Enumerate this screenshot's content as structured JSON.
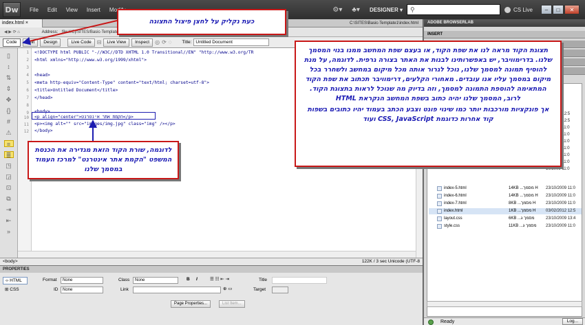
{
  "app": {
    "logo": "Dw",
    "workspace": "DESIGNER",
    "cs_live": "CS Live"
  },
  "menu": [
    "File",
    "Edit",
    "View",
    "Insert",
    "Modify"
  ],
  "document": {
    "tab": "index.html",
    "path": "C:\\SITES\\Basic-Template1\\index.html",
    "address_label": "Address:",
    "address_value": "file:///C|/SITES/Basic-Template1/index.html"
  },
  "toolbar": {
    "code": "Code",
    "split": "Split",
    "design": "Design",
    "live_code": "Live Code",
    "live_view": "Live View",
    "inspect": "Inspect",
    "title_label": "Title:",
    "title_value": "Untitled Document"
  },
  "code_lines": [
    {
      "n": "1",
      "text": "<!DOCTYPE html PUBLIC \"-//W3C//DTD XHTML 1.0 Transitional//EN\" \"http://www.w3.org/TR"
    },
    {
      "n": "2",
      "text": "<html xmlns=\"http://www.w3.org/1999/xhtml\">"
    },
    {
      "n": "3",
      "text": ""
    },
    {
      "n": "4",
      "text": "<head>"
    },
    {
      "n": "5",
      "text": "<meta http-equiv=\"Content-Type\" content=\"text/html; charset=utf-8\">"
    },
    {
      "n": "6",
      "text": "<title>Untitled Document</title>"
    },
    {
      "n": "7",
      "text": "</head>"
    },
    {
      "n": "8",
      "text": ""
    },
    {
      "n": "9",
      "text": "<body>"
    },
    {
      "n": "10",
      "text": "<p align=\"center\">הקמת אתר אינטרנט</p>"
    },
    {
      "n": "11",
      "text": "<p><img alt=\"\" src=\"images/img.jpg\" class=\"img\" /></p>"
    },
    {
      "n": "12",
      "text": "</body>"
    }
  ],
  "status": {
    "tag": "<body>",
    "right": "122K / 3 sec  Unicode (UTF-8"
  },
  "properties": {
    "header": "PROPERTIES",
    "html_btn": "HTML",
    "css_btn": "CSS",
    "format_label": "Format",
    "format_value": "None",
    "class_label": "Class",
    "class_value": "None",
    "id_label": "ID",
    "id_value": "None",
    "link_label": "Link",
    "title_label": "Title",
    "target_label": "Target",
    "bold": "B",
    "italic": "I",
    "page_props": "Page Properties...",
    "list_item": "List Item..."
  },
  "right_panel": {
    "browserlab": "ADOBE BROWSERLAB",
    "insert": "INSERT",
    "col_modified": "odified",
    "files": [
      {
        "name": "",
        "size": "",
        "date": "02/2012 12:5"
      },
      {
        "name": "",
        "size": "",
        "date": "02/2012 12:5"
      },
      {
        "name": "",
        "size": "",
        "date": "10/2009 11:0"
      },
      {
        "name": "",
        "size": "",
        "date": "10/2009 11:0"
      },
      {
        "name": "",
        "size": "",
        "date": "10/2009 11:0"
      },
      {
        "name": "",
        "size": "",
        "date": "10/2009 11:0"
      },
      {
        "name": "",
        "size": "",
        "date": "10/2009 11:0"
      },
      {
        "name": "",
        "size": "",
        "date": "10/2009 11:0"
      },
      {
        "name": "",
        "size": "",
        "date": "10/2009 11:0"
      },
      {
        "name": "index-5.html",
        "size": "14KB ...מסמך H",
        "date": "23/10/2009 11:0"
      },
      {
        "name": "index-6.html",
        "size": "14KB ...מסמך H",
        "date": "23/10/2009 11:0"
      },
      {
        "name": "index-7.html",
        "size": "8KB ...מסמך H",
        "date": "23/10/2009 11:0"
      },
      {
        "name": "index.html",
        "size": "1KB ...מסמך H",
        "date": "03/02/2012 12:5"
      },
      {
        "name": "layout.css",
        "size": "6KB ...מסמך ג",
        "date": "23/10/2009 13:4"
      },
      {
        "name": "style.css",
        "size": "11KB ...מסמך ג",
        "date": "23/10/2009 11:0"
      }
    ],
    "ready": "Ready",
    "log": "Log..."
  },
  "callouts": {
    "top": "כעת נקליק על לחצן פיצול התצוגה",
    "main": "תצוגת הקוד מראה לנו את שפת הקוד, או בעצם שפת המחשב ממנו בנוי המסמך שלנו. בדרימוויבר, יש באפשרותינו לבנות את האתר בצורה גרפית. לדוגמה, על מנת להוסיף תמונה למסמך שלנו, נוכל לגרור אותה מכל מיקום במחשב ולשחרר בכל מיקום במסמך עליו אנו עובדים. מאחורי הקלעים, דרימוויבר תכתוב את שפת הקוד המתאימה להוספת התמונה למסמך, וזה בדיוק מה שנוכל לראות בתצוגת הקוד. לרוב, המסמך שלנו יהיה כתוב בשפת המחשב הנקראת HTML",
    "main2": "אך פונקציות מורכבות יותר כמו שינוי פונט וצבע הכתב בעמוד יהיו כתובים בשפות קוד אחרות כדוגמת CSS, JavaScript ועוד",
    "bottom": "לדוגמה, שורת הקוד הזאת מגדירה את הכנסת המשפט \"הקמת אתר אינטרנט\" למרכז העמוד במסמך שלנו"
  },
  "colors": {
    "callout_border": "#c81717",
    "callout_text": "#1a1ab4",
    "highlight_box": "#1c1cb0"
  }
}
